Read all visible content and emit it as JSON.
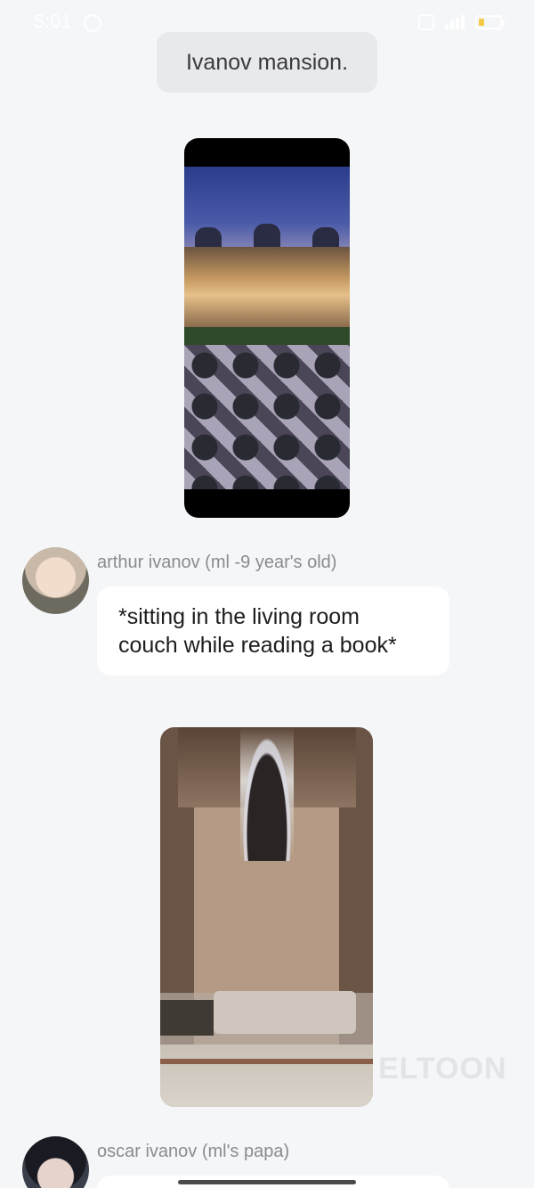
{
  "status_bar": {
    "time": "5:01",
    "icons": [
      "whatsapp-icon",
      "vibrate-icon",
      "signal-icon",
      "battery-icon"
    ],
    "battery_color": "#f3c945"
  },
  "chat": {
    "narration": "Ivanov mansion.",
    "messages": [
      {
        "sender": "arthur ivanov (ml -9 year's old)",
        "text_line1": "*sitting in the living room",
        "text_line2": "couch while reading a book*"
      },
      {
        "sender": "oscar ivanov (ml's papa)"
      }
    ],
    "images": [
      "mansion-exterior",
      "living-room-interior"
    ]
  },
  "watermark": "ELTOON"
}
